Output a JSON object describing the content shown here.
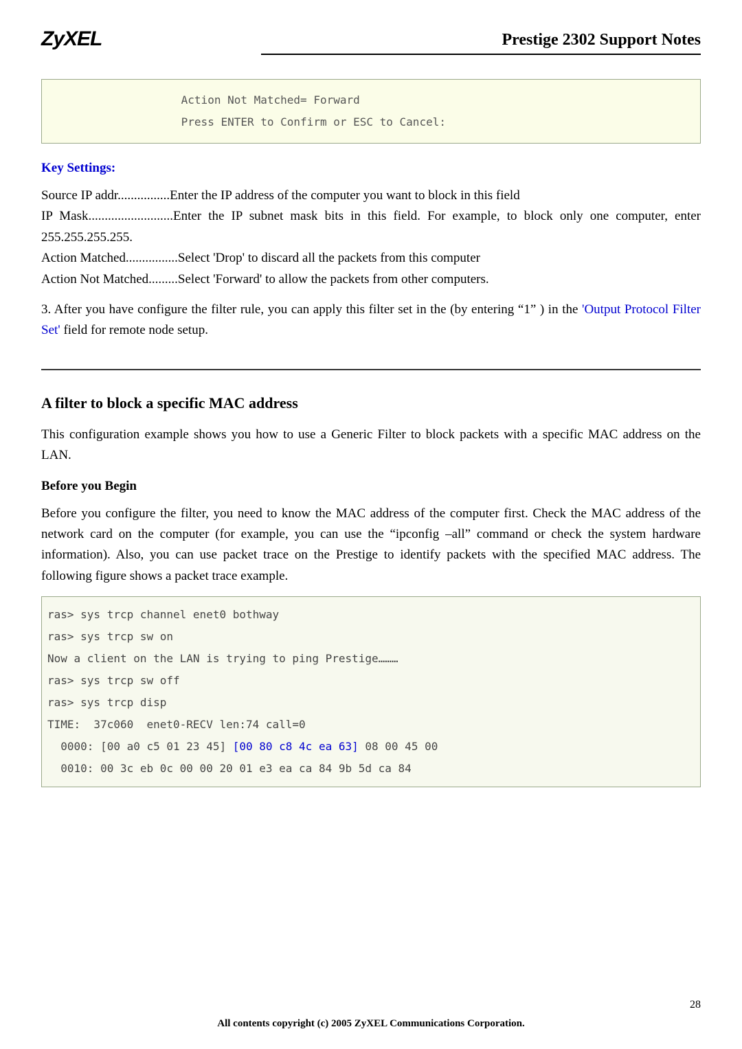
{
  "header": {
    "logo": "ZyXEL",
    "title": "Prestige 2302 Support Notes"
  },
  "codebox": {
    "line1": "                    Action Not Matched= Forward",
    "line2": "                    Press ENTER to Confirm or ESC to Cancel:"
  },
  "key_settings": {
    "heading": "Key Settings:",
    "line1": "Source IP addr................Enter the IP address of the computer you want to block in this field",
    "line2": "IP Mask..........................Enter the IP subnet mask bits in this field. For example, to block only one computer, enter 255.255.255.255.",
    "line3": "Action Matched................Select 'Drop' to discard all the packets from this computer",
    "line4": "Action Not Matched.........Select 'Forward' to allow the packets from other computers."
  },
  "para3": {
    "prefix": "3. After you have configure the filter rule, you can apply this filter set in the (by entering  “1” ) in the ",
    "link": "'Output Protocol Filter Set'",
    "suffix": " field for remote node setup."
  },
  "section": {
    "heading": "A filter to block a specific MAC address",
    "intro": "This configuration example shows you how to use a Generic Filter to block packets with a specific MAC address on the LAN.",
    "subhead": "Before you Begin",
    "before_text": "Before you configure the filter, you need to know the MAC address of the computer first. Check the MAC address of the network card on the computer (for example, you can use the  “ipconfig –all”  command or check the system hardware information). Also, you can use packet trace on the Prestige to identify packets with the specified MAC address. The following figure shows a packet trace example."
  },
  "terminal": {
    "l1": "ras> sys trcp channel enet0 bothway",
    "l2": "ras> sys trcp sw on",
    "l3": "Now a client on the LAN is trying to ping Prestige………",
    "l4": "ras> sys trcp sw off",
    "l5": "ras> sys trcp disp",
    "l6": "TIME:  37c060  enet0-RECV len:74 call=0",
    "l7a": "  0000: [00 a0 c5 01 23 45] ",
    "l7b": "[00 80 c8 4c ea 63]",
    "l7c": " 08 00 45 00",
    "l8": "  0010: 00 3c eb 0c 00 00 20 01 e3 ea ca 84 9b 5d ca 84"
  },
  "footer": {
    "copyright": "All contents copyright (c) 2005 ZyXEL Communications Corporation.",
    "page": "28"
  }
}
